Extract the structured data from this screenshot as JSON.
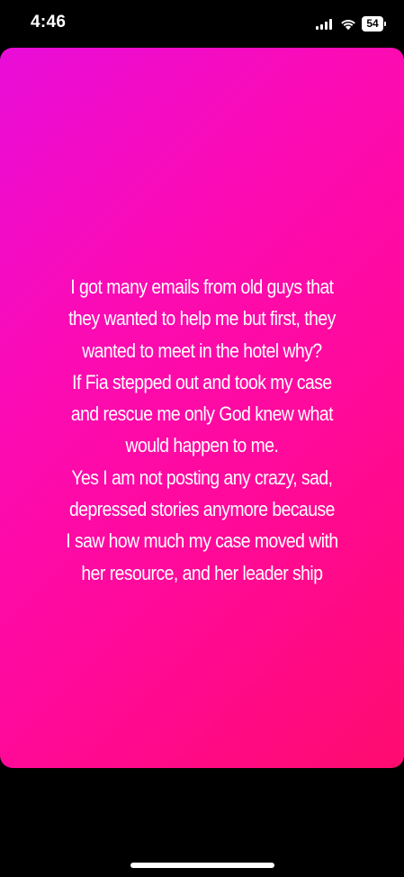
{
  "status_bar": {
    "time": "4:46",
    "battery_level": "54",
    "icons": [
      "cellular-signal-icon",
      "wifi-icon",
      "battery-icon"
    ]
  },
  "story": {
    "background_gradient": [
      "#e90dd9",
      "#fb0bb5",
      "#ff0a9c",
      "#ff0b6f"
    ],
    "text_color": "#ffffff",
    "lines": [
      "I got many emails from old guys that",
      "they wanted to help me but first, they",
      "wanted to meet in the hotel why?",
      "If Fia stepped out and took my case",
      "and rescue me only God knew what",
      "would happen to me.",
      "Yes I am not posting any crazy, sad,",
      "depressed stories anymore because",
      "I saw how much my case moved with",
      "her resource, and her leader ship"
    ]
  }
}
